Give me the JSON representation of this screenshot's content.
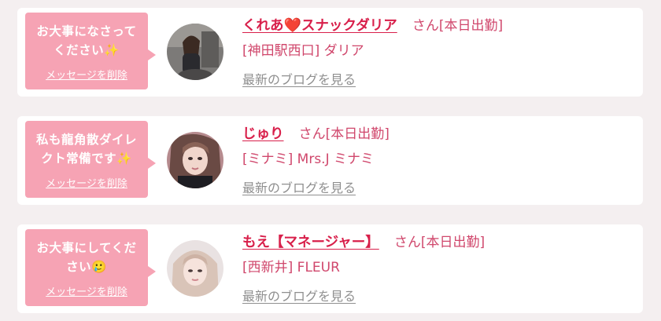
{
  "cards": [
    {
      "message": "お大事になさってください✨",
      "delete_label": "メッセージを削除",
      "name_pre": "くれあ",
      "name_heart": "❤️",
      "name_post": "スナックダリア",
      "suffix": "さん[本日出勤]",
      "shop": "[神田駅西口] ダリア",
      "blog_link": "最新のブログを見る",
      "avatar_icon": "cast-photo-avatar"
    },
    {
      "message": "私も龍角散ダイレクト常備です✨",
      "delete_label": "メッセージを削除",
      "name": "じゅり",
      "suffix": "さん[本日出勤]",
      "shop": "[ミナミ] Mrs.J ミナミ",
      "blog_link": "最新のブログを見る",
      "avatar_icon": "cast-photo-avatar"
    },
    {
      "message": "お大事にしてください🥲",
      "delete_label": "メッセージを削除",
      "name": "もえ【マネージャー】",
      "suffix": "さん[本日出勤]",
      "shop": "[西新井] FLEUR",
      "blog_link": "最新のブログを見る",
      "avatar_icon": "cast-photo-avatar"
    }
  ],
  "colors": {
    "bubble": "#f6a3b4",
    "name": "#d81f4a",
    "shop": "#d0476c",
    "blog": "#8f8f8f"
  }
}
